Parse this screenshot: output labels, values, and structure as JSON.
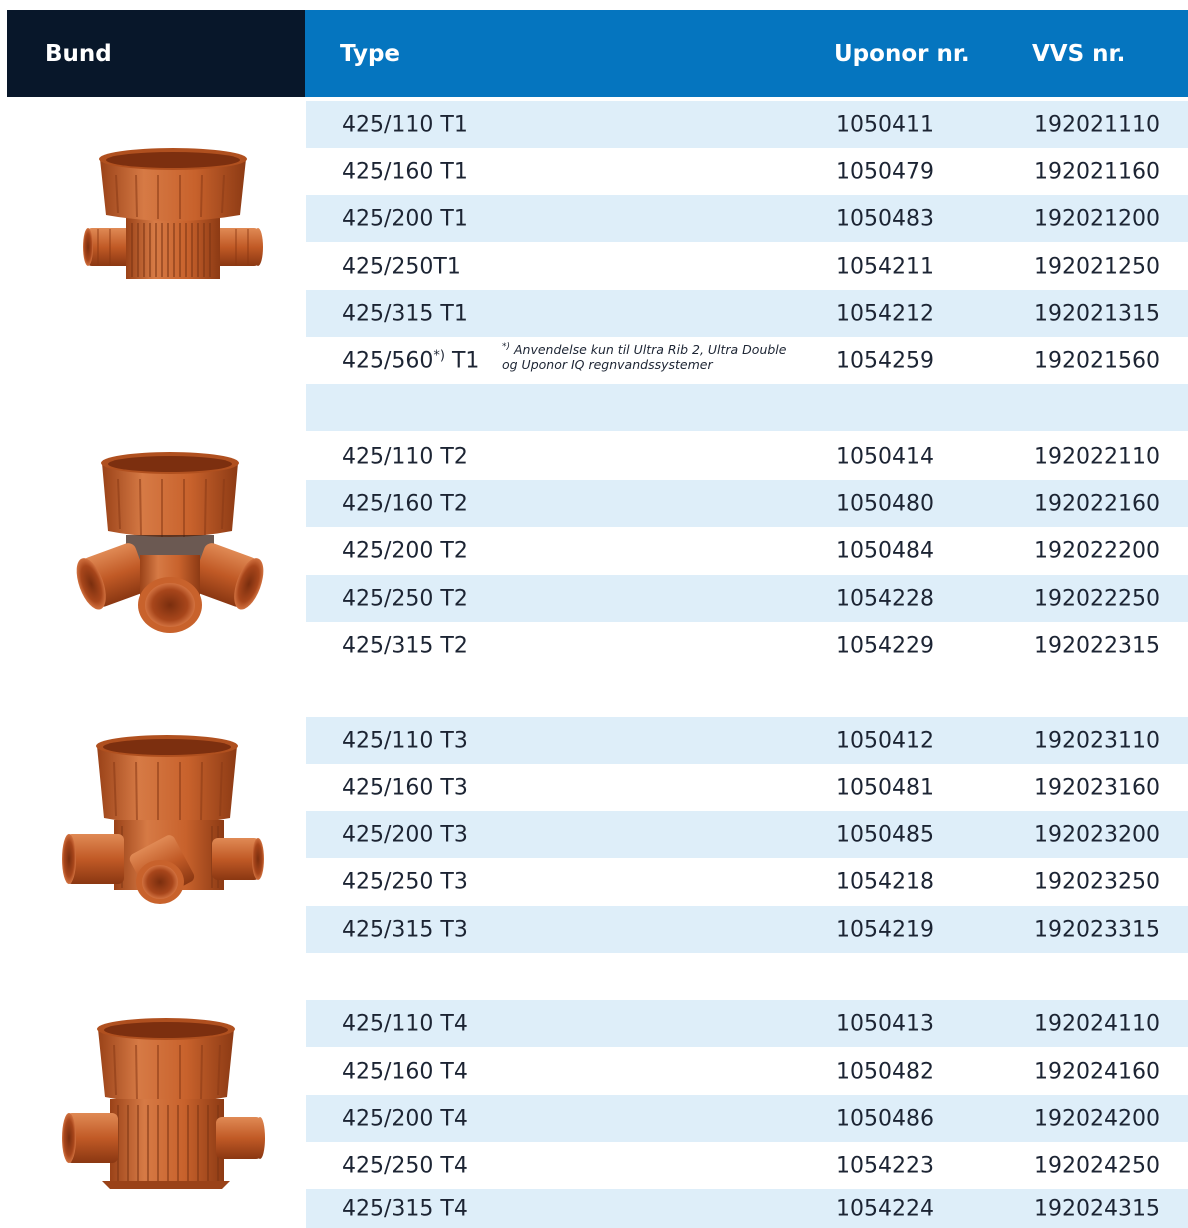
{
  "header": {
    "bund": "Bund",
    "type": "Type",
    "uponor": "Uponor nr.",
    "vvs": "VVS nr."
  },
  "groups": [
    {
      "image": "T1 straight-through chamber bottom",
      "rows": [
        {
          "type": "425/110 T1",
          "uponor": "1050411",
          "vvs": "192021110"
        },
        {
          "type": "425/160 T1",
          "uponor": "1050479",
          "vvs": "192021160"
        },
        {
          "type": "425/200 T1",
          "uponor": "1050483",
          "vvs": "192021200"
        },
        {
          "type": "425/250T1",
          "uponor": "1054211",
          "vvs": "192021250"
        },
        {
          "type": "425/315 T1",
          "uponor": "1054212",
          "vvs": "192021315"
        },
        {
          "type_main": "425/560",
          "type_sup": "*)",
          "type_suffix": " T1",
          "uponor": "1054259",
          "vvs": "192021560",
          "note_mark": "*)",
          "note_line1": " Anvendelse kun til Ultra Rib 2, Ultra Double",
          "note_line2": "og Uponor IQ regnvandssystemer"
        }
      ]
    },
    {
      "image": "T2 chamber bottom with three inlets",
      "rows": [
        {
          "type": "425/110 T2",
          "uponor": "1050414",
          "vvs": "192022110"
        },
        {
          "type": "425/160 T2",
          "uponor": "1050480",
          "vvs": "192022160"
        },
        {
          "type": "425/200 T2",
          "uponor": "1050484",
          "vvs": "192022200"
        },
        {
          "type": "425/250 T2",
          "uponor": "1054228",
          "vvs": "192022250"
        },
        {
          "type": "425/315 T2",
          "uponor": "1054229",
          "vvs": "192022315"
        }
      ]
    },
    {
      "image": "T3 chamber bottom",
      "rows": [
        {
          "type": "425/110 T3",
          "uponor": "1050412",
          "vvs": "192023110"
        },
        {
          "type": "425/160 T3",
          "uponor": "1050481",
          "vvs": "192023160"
        },
        {
          "type": "425/200 T3",
          "uponor": "1050485",
          "vvs": "192023200"
        },
        {
          "type": "425/250 T3",
          "uponor": "1054218",
          "vvs": "192023250"
        },
        {
          "type": "425/315 T3",
          "uponor": "1054219",
          "vvs": "192023315"
        }
      ]
    },
    {
      "image": "T4 chamber bottom",
      "rows": [
        {
          "type": "425/110 T4",
          "uponor": "1050413",
          "vvs": "192024110"
        },
        {
          "type": "425/160 T4",
          "uponor": "1050482",
          "vvs": "192024160"
        },
        {
          "type": "425/200 T4",
          "uponor": "1050486",
          "vvs": "192024200"
        },
        {
          "type": "425/250 T4",
          "uponor": "1054223",
          "vvs": "192024250"
        },
        {
          "type": "425/315 T4",
          "uponor": "1054224",
          "vvs": "192024315"
        }
      ]
    }
  ],
  "colors": {
    "header_dark": "#08172a",
    "header_blue": "#0575bf",
    "row_shade": "#deeef9",
    "pipe_orange": "#c8602a"
  }
}
